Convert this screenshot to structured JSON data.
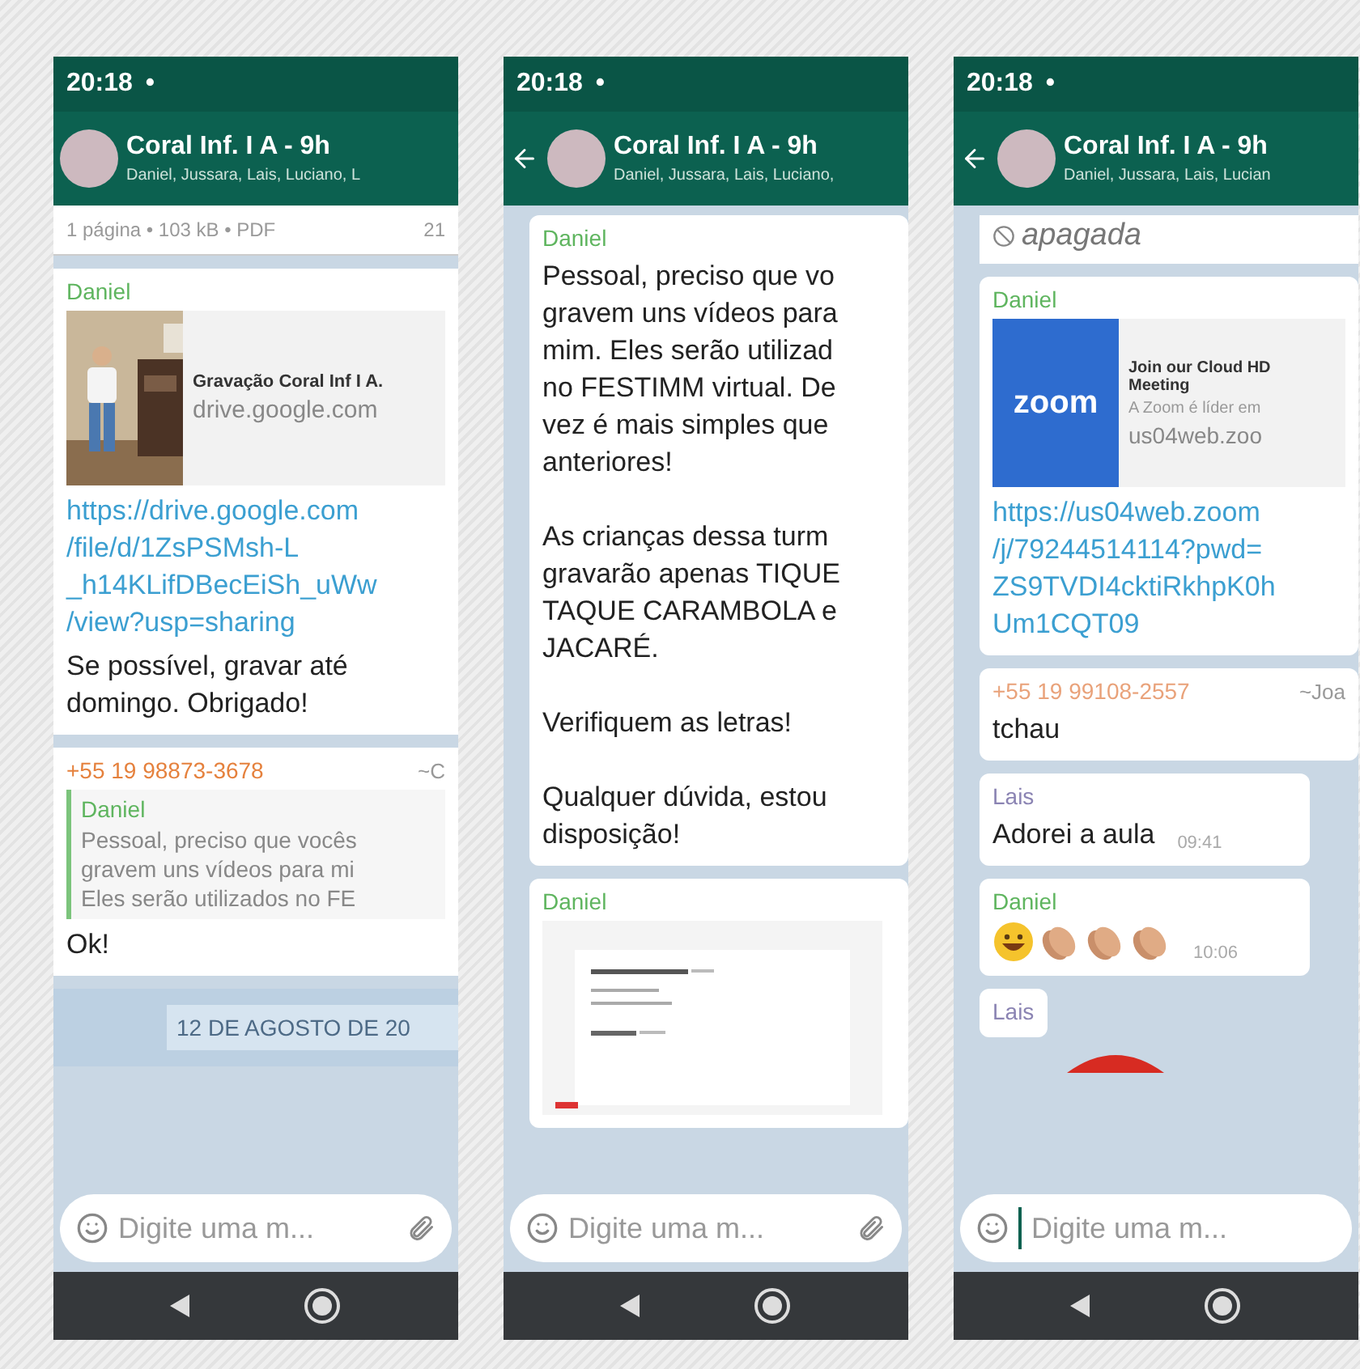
{
  "phones": [
    {
      "status": {
        "time": "20:18",
        "dot": "•"
      },
      "header": {
        "back_button": false,
        "title": "Coral Inf. I A - 9h",
        "subtitle": "Daniel, Jussara, Lais, Luciano, L"
      },
      "messages": [
        {
          "kind": "file_footer",
          "meta": "1 página • 103 kB • PDF",
          "time": "21"
        },
        {
          "kind": "link",
          "sender": "Daniel",
          "color": "#5fb55f",
          "preview": {
            "title": "Gravação Coral Inf I A.",
            "domain": "drive.google.com"
          },
          "url": "https://drive.google.com\n/file/d/1ZsPSMsh-L\n_h14KLifDBecEiSh_uWw\n/view?usp=sharing",
          "text": "Se possível, gravar até\ndomingo. Obrigado!"
        },
        {
          "kind": "reply",
          "sender": "+55 19 98873-3678",
          "color": "#e5813d",
          "alias": "~C",
          "quote": {
            "sender": "Daniel",
            "color": "#5fb55f",
            "text": "Pessoal, preciso que vocês\ngravem uns vídeos para mi\nEles serão utilizados no FE"
          },
          "text": "Ok!"
        },
        {
          "kind": "date",
          "text": "12 DE AGOSTO DE 20"
        }
      ],
      "composer": {
        "placeholder": "Digite uma m...",
        "focused": false,
        "attach": true
      }
    },
    {
      "status": {
        "time": "20:18",
        "dot": "•"
      },
      "header": {
        "back_button": true,
        "title": "Coral Inf. I A - 9h",
        "subtitle": "Daniel, Jussara, Lais, Luciano,"
      },
      "messages": [
        {
          "kind": "text",
          "sender": "Daniel",
          "color": "#5fb55f",
          "text": "Pessoal, preciso que vo\ngravem uns vídeos para\nmim. Eles serão utilizad\nno FESTIMM virtual. De\nvez é mais simples que\nanteriores!\n\nAs crianças dessa turm\ngravarão apenas TIQUE\nTAQUE CARAMBOLA e\nJACARÉ.\n\nVerifiquem as letras!\n\nQualquer dúvida, estou\ndisposição!"
        },
        {
          "kind": "document",
          "sender": "Daniel",
          "color": "#5fb55f"
        }
      ],
      "composer": {
        "placeholder": "Digite uma m...",
        "focused": false,
        "attach": true
      }
    },
    {
      "status": {
        "time": "20:18",
        "dot": "•"
      },
      "header": {
        "back_button": true,
        "title": "Coral Inf. I A - 9h",
        "subtitle": "Daniel, Jussara, Lais, Lucian"
      },
      "messages": [
        {
          "kind": "deleted",
          "text": "apagada"
        },
        {
          "kind": "link",
          "sender": "Daniel",
          "color": "#5fb55f",
          "preview": {
            "kind": "logo",
            "logo_text": "zoom",
            "title": "Join our Cloud HD\nMeeting",
            "description": "A Zoom é líder em",
            "domain": "us04web.zoo"
          },
          "url": "https://us04web.zoom\n/j/79244514114?pwd=\nZS9TVDI4cktiRkhpK0h\nUm1CQT09"
        },
        {
          "kind": "text",
          "sender": "+55 19 99108-2557",
          "color": "#e9a27a",
          "alias": "~Joa",
          "text": "tchau"
        },
        {
          "kind": "text",
          "sender": "Lais",
          "color": "#8b84b3",
          "text": "Adorei a aula",
          "time": "09:41"
        },
        {
          "kind": "emoji",
          "sender": "Daniel",
          "color": "#5fb55f",
          "emojis": [
            {
              "kind": "grin"
            },
            {
              "kind": "clap"
            },
            {
              "kind": "clap"
            },
            {
              "kind": "clap"
            }
          ],
          "time": "10:06"
        },
        {
          "kind": "sticker",
          "sender": "Lais",
          "color": "#8b84b3"
        }
      ],
      "composer": {
        "placeholder": "Digite uma m...",
        "focused": true,
        "attach": false
      }
    }
  ]
}
